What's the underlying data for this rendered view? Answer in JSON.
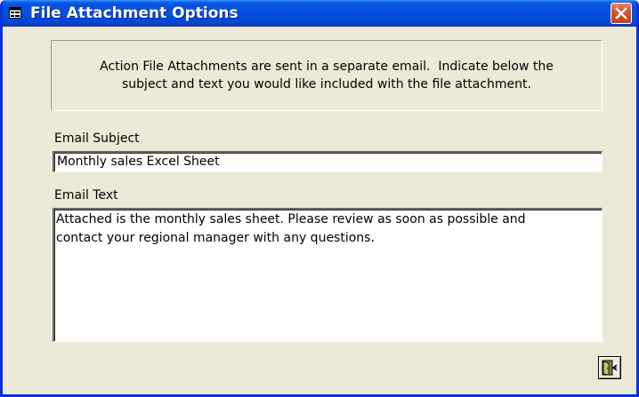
{
  "window": {
    "title": "File Attachment Options",
    "icon": "form-icon",
    "close_icon": "close-x-icon"
  },
  "info": {
    "line1": "Action File Attachments are sent in a separate email.  Indicate below the",
    "line2": "subject and text you would like included with the file attachment."
  },
  "email_subject": {
    "label": "Email Subject",
    "value": "Monthly sales Excel Sheet"
  },
  "email_text": {
    "label": "Email Text",
    "line1": "Attached is the monthly sales sheet. Please review as soon as possible and",
    "line2": "contact your regional manager with any questions."
  },
  "footer": {
    "close_button_icon": "exit-door-icon"
  },
  "colors": {
    "title_bar": "#0450dc",
    "window_bg": "#ece9d8",
    "close_button": "#d8552f"
  }
}
